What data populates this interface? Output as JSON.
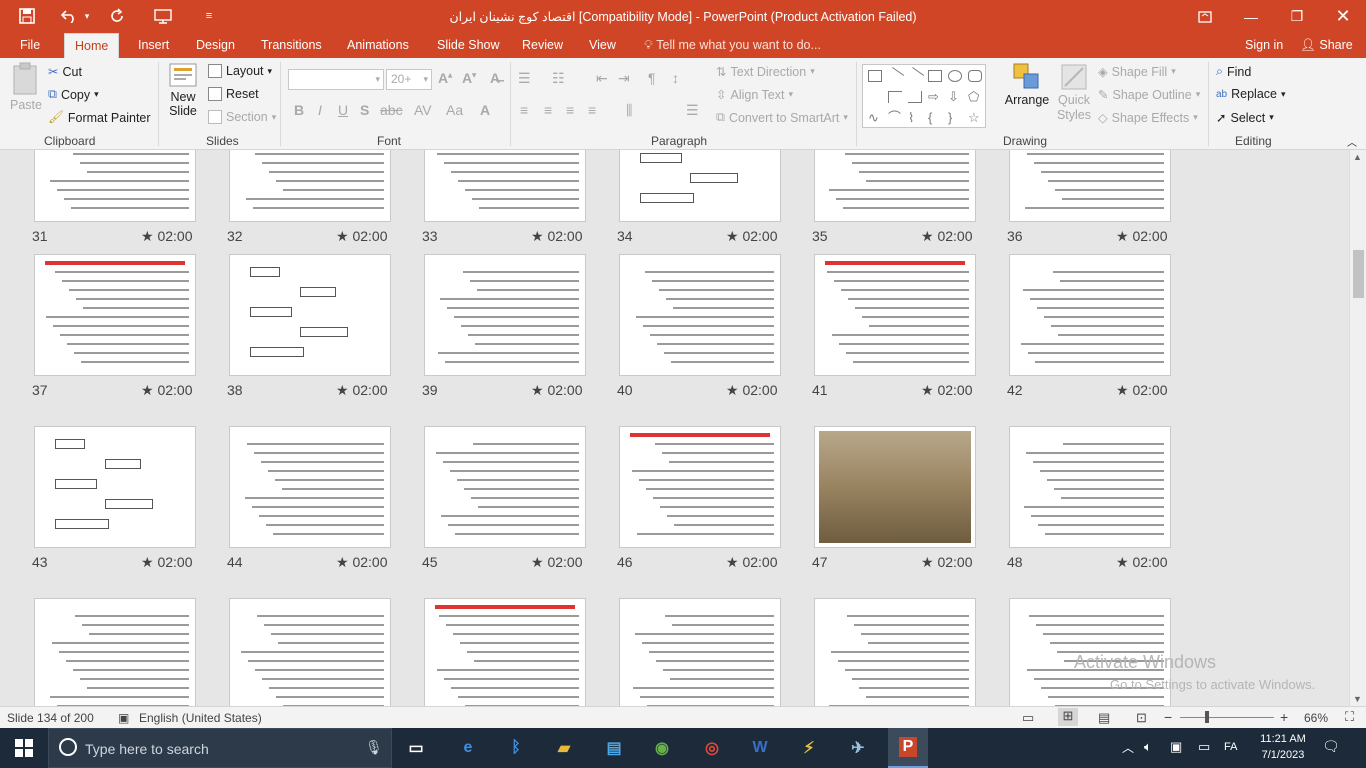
{
  "window": {
    "title": "اقتصاد کوچ نشینان ایران [Compatibility Mode] - PowerPoint (Product Activation Failed)"
  },
  "quick_access": {
    "save_icon": "save-icon",
    "undo_icon": "undo-icon",
    "redo_icon": "redo-icon"
  },
  "tabs": [
    "File",
    "Home",
    "Insert",
    "Design",
    "Transitions",
    "Animations",
    "Slide Show",
    "Review",
    "View"
  ],
  "active_tab": "Home",
  "tell_me": "Tell me what you want to do...",
  "account": {
    "sign_in": "Sign in",
    "share": "Share"
  },
  "ribbon": {
    "clipboard": {
      "label": "Clipboard",
      "paste": "Paste",
      "cut": "Cut",
      "copy": "Copy",
      "format_painter": "Format Painter"
    },
    "slides": {
      "label": "Slides",
      "new_slide_line1": "New",
      "new_slide_line2": "Slide",
      "layout": "Layout",
      "reset": "Reset",
      "section": "Section"
    },
    "font": {
      "label": "Font",
      "font_size": "20+"
    },
    "paragraph": {
      "label": "Paragraph",
      "text_direction": "Text Direction",
      "align_text": "Align Text",
      "convert_smartart": "Convert to SmartArt"
    },
    "drawing": {
      "label": "Drawing",
      "arrange": "Arrange",
      "quick_styles_line1": "Quick",
      "quick_styles_line2": "Styles",
      "shape_fill": "Shape Fill",
      "shape_outline": "Shape Outline",
      "shape_effects": "Shape Effects"
    },
    "editing": {
      "label": "Editing",
      "find": "Find",
      "replace": "Replace",
      "select": "Select"
    }
  },
  "slides": [
    {
      "num": "31",
      "time": "02:00",
      "kind": "text"
    },
    {
      "num": "32",
      "time": "02:00",
      "kind": "text"
    },
    {
      "num": "33",
      "time": "02:00",
      "kind": "text"
    },
    {
      "num": "34",
      "time": "02:00",
      "kind": "diagram"
    },
    {
      "num": "35",
      "time": "02:00",
      "kind": "text-red"
    },
    {
      "num": "36",
      "time": "02:00",
      "kind": "text"
    },
    {
      "num": "37",
      "time": "02:00",
      "kind": "text-red"
    },
    {
      "num": "38",
      "time": "02:00",
      "kind": "diagram"
    },
    {
      "num": "39",
      "time": "02:00",
      "kind": "text"
    },
    {
      "num": "40",
      "time": "02:00",
      "kind": "text"
    },
    {
      "num": "41",
      "time": "02:00",
      "kind": "text-red"
    },
    {
      "num": "42",
      "time": "02:00",
      "kind": "text"
    },
    {
      "num": "43",
      "time": "02:00",
      "kind": "diagram"
    },
    {
      "num": "44",
      "time": "02:00",
      "kind": "text"
    },
    {
      "num": "45",
      "time": "02:00",
      "kind": "text"
    },
    {
      "num": "46",
      "time": "02:00",
      "kind": "text-red"
    },
    {
      "num": "47",
      "time": "02:00",
      "kind": "photo"
    },
    {
      "num": "48",
      "time": "02:00",
      "kind": "text"
    },
    {
      "num": "",
      "time": "",
      "kind": "text"
    },
    {
      "num": "",
      "time": "",
      "kind": "text"
    },
    {
      "num": "",
      "time": "",
      "kind": "text-red"
    },
    {
      "num": "",
      "time": "",
      "kind": "text"
    },
    {
      "num": "",
      "time": "",
      "kind": "text"
    },
    {
      "num": "",
      "time": "",
      "kind": "text"
    }
  ],
  "status": {
    "slide_info": "Slide 134 of 200",
    "language": "English (United States)",
    "zoom": "66%"
  },
  "watermark": {
    "line1": "Activate Windows",
    "line2": "Go to Settings to activate Windows."
  },
  "taskbar": {
    "search_placeholder": "Type here to search",
    "language": "FA",
    "time": "11:21 AM",
    "date": "7/1/2023"
  }
}
